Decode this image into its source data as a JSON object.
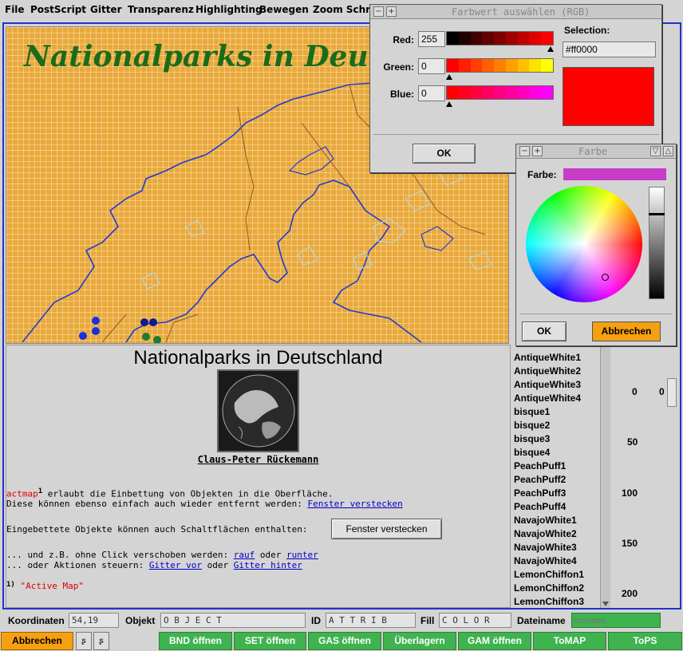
{
  "menu": [
    "File",
    "PostScript",
    "Gitter",
    "Transparenz",
    "Highlighting",
    "Bewegen",
    "Zoom Schrift"
  ],
  "map": {
    "title": "Nationalparks in Deutschland"
  },
  "html_pane": {
    "title": "Nationalparks in Deutschland",
    "author": "Claus-Peter Rückemann",
    "line1_prefix": "actmap",
    "line1_sup": "1",
    "line1_rest": " erlaubt die Einbettung von Objekten in die Oberfläche.",
    "line2_text": "Diese können ebenso einfach auch wieder entfernt werden: ",
    "line2_link": "Fenster verstecken",
    "line3_text": "Eingebettete Objekte können auch Schaltflächen enthalten:",
    "button_label": "Fenster verstecken",
    "line4_text": "... und z.B. ohne Click verschoben werden: ",
    "line4_link1": "rauf",
    "line4_mid": " oder ",
    "line4_link2": "runter",
    "line5_text": "... oder Aktionen steuern: ",
    "line5_link1": "Gitter vor",
    "line5_mid": " oder ",
    "line5_link2": "Gitter hinter",
    "footnote_num": "1)",
    "footnote_text": "\"Active Map\""
  },
  "color_list": [
    "AntiqueWhite1",
    "AntiqueWhite2",
    "AntiqueWhite3",
    "AntiqueWhite4",
    "bisque1",
    "bisque2",
    "bisque3",
    "bisque4",
    "PeachPuff1",
    "PeachPuff2",
    "PeachPuff3",
    "PeachPuff4",
    "NavajoWhite1",
    "NavajoWhite2",
    "NavajoWhite3",
    "NavajoWhite4",
    "LemonChiffon1",
    "LemonChiffon2",
    "LemonChiffon3"
  ],
  "scale": {
    "ticks": [
      "0",
      "50",
      "100",
      "150",
      "200"
    ],
    "value": "0"
  },
  "status": {
    "koordinaten_label": "Koordinaten",
    "koordinaten_value": "54,19",
    "objekt_label": "Objekt",
    "objekt_value": "O B J E C T",
    "id_label": "ID",
    "id_value": "A T T R I B",
    "fill_label": "Fill",
    "fill_value": "C O L O R",
    "dateiname_label": "Dateiname",
    "dateiname_placeholder": "noname"
  },
  "bottom_buttons": {
    "abbrechen": "Abbrechen",
    "bnd": "BND öffnen",
    "set": "SET öffnen",
    "gas": "GAS öffnen",
    "ueberlagern": "Überlagern",
    "gam": "GAM öffnen",
    "tomap": "ToMAP",
    "tops": "ToPS"
  },
  "rgb_dialog": {
    "title": "Farbwert auswählen (RGB)",
    "red_label": "Red:",
    "red_value": "255",
    "green_label": "Green:",
    "green_value": "0",
    "blue_label": "Blue:",
    "blue_value": "0",
    "selection_label": "Selection:",
    "selection_value": "#ff0000",
    "ok_label": "OK",
    "selected_color": "#ff0000"
  },
  "farbe_dialog": {
    "title": "Farbe",
    "farbe_label": "Farbe:",
    "current_color": "#c83cc8",
    "ok_label": "OK",
    "cancel_label": "Abbrechen"
  },
  "colors": {
    "map_bg": "#e9a93a",
    "map_title": "#1a6b1a",
    "button_green": "#3eb34f",
    "button_orange": "#f5a010",
    "workspace_border": "#2233cc"
  }
}
